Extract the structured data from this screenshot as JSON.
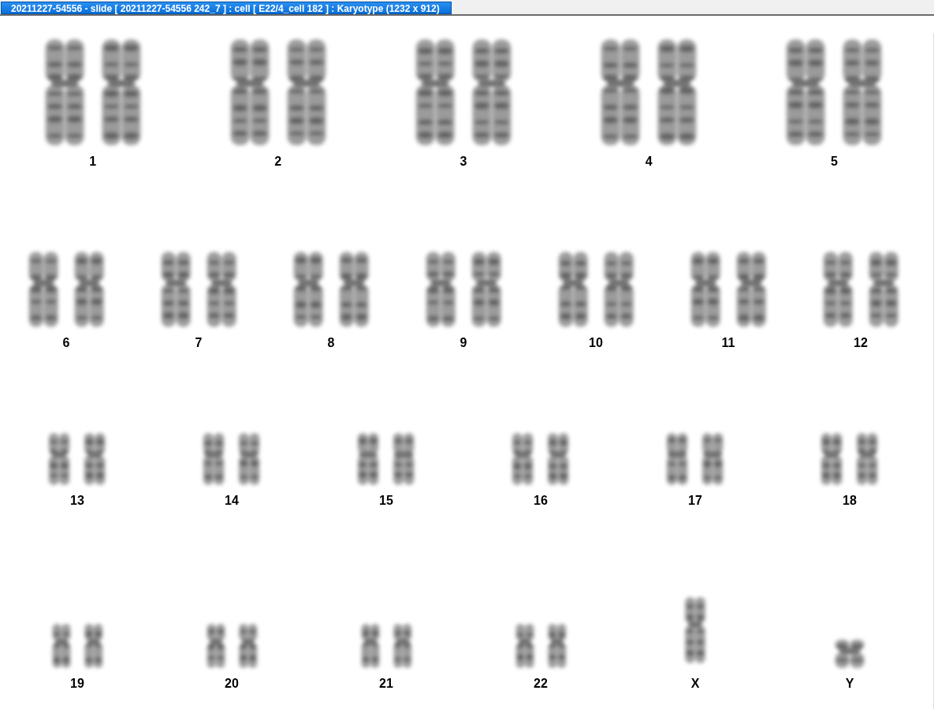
{
  "tab": {
    "title": "20211227-54556 - slide [ 20211227-54556 242_7 ] : cell [ E22/4_cell 182 ] : Karyotype  (1232 x 912)",
    "selected": true
  },
  "karyotype_rows": [
    {
      "chromosomes": [
        {
          "label": "1",
          "kind": "pair"
        },
        {
          "label": "2",
          "kind": "pair"
        },
        {
          "label": "3",
          "kind": "pair"
        },
        {
          "label": "4",
          "kind": "pair"
        },
        {
          "label": "5",
          "kind": "pair"
        }
      ]
    },
    {
      "chromosomes": [
        {
          "label": "6",
          "kind": "pair"
        },
        {
          "label": "7",
          "kind": "pair"
        },
        {
          "label": "8",
          "kind": "pair"
        },
        {
          "label": "9",
          "kind": "pair"
        },
        {
          "label": "10",
          "kind": "pair"
        },
        {
          "label": "11",
          "kind": "pair"
        },
        {
          "label": "12",
          "kind": "pair"
        }
      ]
    },
    {
      "chromosomes": [
        {
          "label": "13",
          "kind": "pair"
        },
        {
          "label": "14",
          "kind": "pair"
        },
        {
          "label": "15",
          "kind": "pair"
        },
        {
          "label": "16",
          "kind": "pair"
        },
        {
          "label": "17",
          "kind": "pair"
        },
        {
          "label": "18",
          "kind": "pair"
        }
      ]
    },
    {
      "chromosomes": [
        {
          "label": "19",
          "kind": "pair"
        },
        {
          "label": "20",
          "kind": "pair"
        },
        {
          "label": "21",
          "kind": "pair"
        },
        {
          "label": "22",
          "kind": "pair"
        },
        {
          "label": "X",
          "kind": "single"
        },
        {
          "label": "Y",
          "kind": "single"
        }
      ]
    }
  ]
}
